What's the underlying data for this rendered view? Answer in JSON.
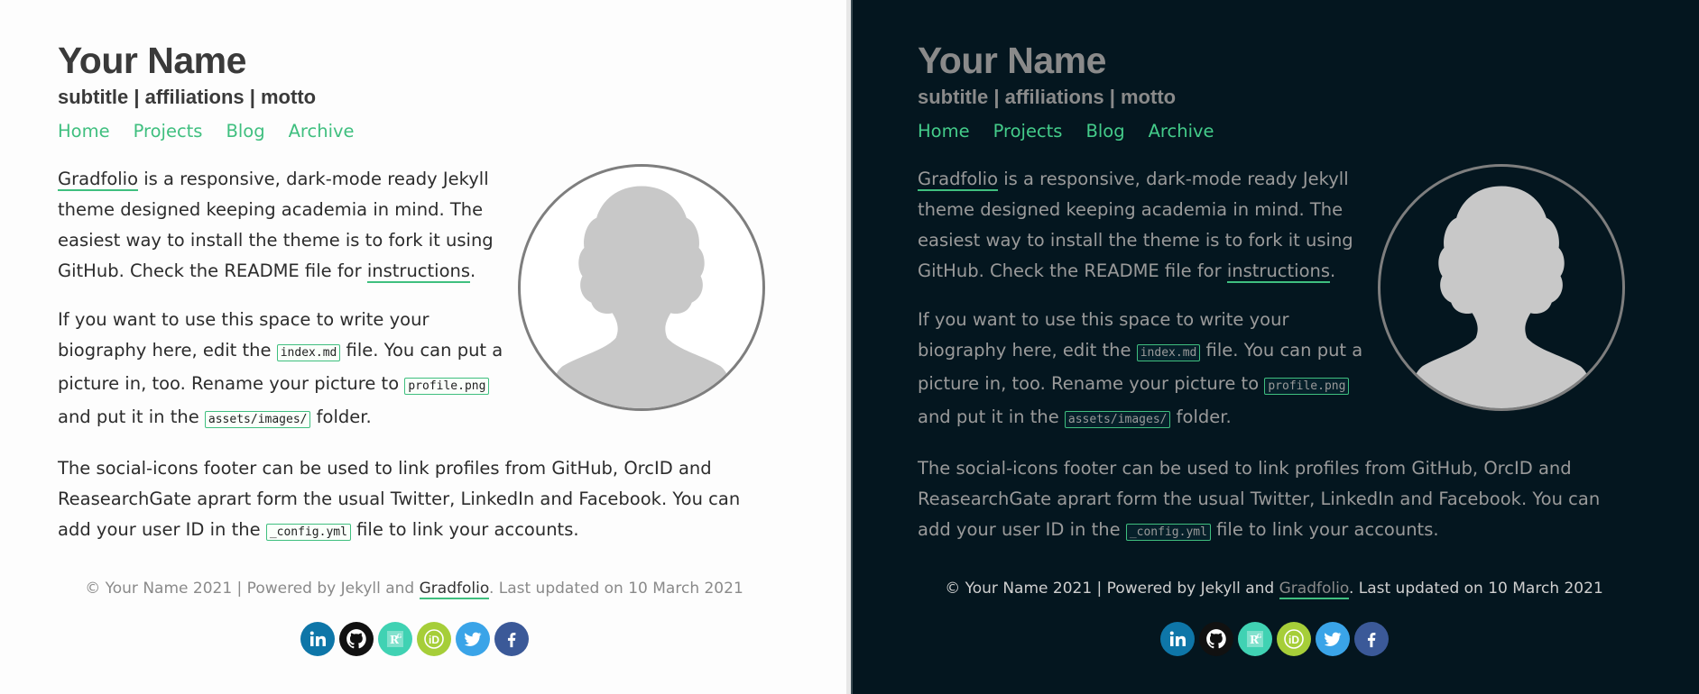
{
  "site": {
    "title": "Your Name",
    "subtitle": "subtitle | affiliations | motto"
  },
  "nav": [
    {
      "label": "Home"
    },
    {
      "label": "Projects"
    },
    {
      "label": "Blog"
    },
    {
      "label": "Archive"
    }
  ],
  "intro": {
    "p1_link": "Gradfolio",
    "p1_text_a": " is a responsive, dark-mode ready Jekyll theme designed keeping academia in mind. The easiest way to install the theme is to fork it using GitHub. Check the README file for ",
    "p1_link2": "instructions",
    "p1_text_b": ".",
    "p2_text_a": "If you want to use this space to write your biography here, edit the ",
    "p2_code1": "index.md",
    "p2_text_b": " file. You can put a picture in, too. Rename your picture to ",
    "p2_code2": "profile.png",
    "p2_text_c": " and put it in the ",
    "p2_code3": "assets/images/",
    "p2_text_d": " folder.",
    "p3_text_a": "The social-icons footer can be used to link profiles from GitHub, OrcID and ReasearchGate aprart form the usual Twitter, LinkedIn and Facebook. You can add your user ID in the ",
    "p3_code": "_config.yml",
    "p3_text_b": " file to link your accounts."
  },
  "footer": {
    "text_a": "© Your Name 2021 | Powered by Jekyll and ",
    "link": "Gradfolio",
    "text_b": ". Last updated on 10 March 2021"
  },
  "socials": [
    {
      "name": "linkedin-icon",
      "color": "#0e76a8",
      "glyph": "in"
    },
    {
      "name": "github-icon",
      "color": "#111111",
      "glyph": "gh"
    },
    {
      "name": "researchgate-icon",
      "color": "#40d2b3",
      "glyph": "R"
    },
    {
      "name": "orcid-icon",
      "color": "#a6ce39",
      "glyph": "iD"
    },
    {
      "name": "twitter-icon",
      "color": "#3aa4e8",
      "glyph": "tw"
    },
    {
      "name": "facebook-icon",
      "color": "#3b5998",
      "glyph": "f"
    }
  ],
  "colors": {
    "accent": "#3fbf7f",
    "light_bg": "#fdfdfd",
    "dark_bg": "#04161f"
  }
}
